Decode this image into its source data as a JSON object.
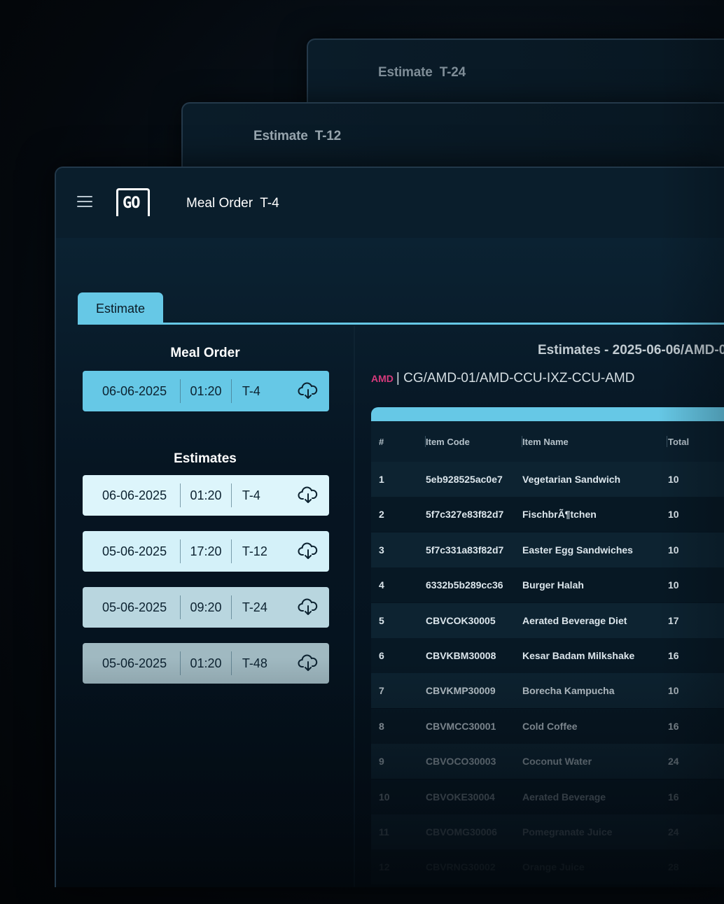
{
  "background_windows": [
    {
      "title": "Estimate  T-24"
    },
    {
      "title": "Estimate  T-12"
    }
  ],
  "topbar": {
    "logo_text": "GO",
    "title": "Meal Order  T-4"
  },
  "tabs": [
    {
      "label": "Estimate"
    }
  ],
  "left_panel": {
    "meal_order_title": "Meal Order",
    "meal_order": {
      "date": "06-06-2025",
      "time": "01:20",
      "tag": "T-4"
    },
    "estimates_title": "Estimates",
    "estimates": [
      {
        "date": "06-06-2025",
        "time": "01:20",
        "tag": "T-4"
      },
      {
        "date": "05-06-2025",
        "time": "17:20",
        "tag": "T-12"
      },
      {
        "date": "05-06-2025",
        "time": "09:20",
        "tag": "T-24"
      },
      {
        "date": "05-06-2025",
        "time": "01:20",
        "tag": "T-48"
      }
    ]
  },
  "right_panel": {
    "header": "Estimates - 2025-06-06/AMD-0",
    "route_tag": "AMD",
    "route": "| CG/AMD-01/AMD-CCU-IXZ-CCU-AMD",
    "columns": [
      "#",
      "Item Code",
      "Item Name",
      "Total"
    ],
    "rows": [
      {
        "n": "1",
        "code": "5eb928525ac0e7",
        "name": "Vegetarian Sandwich",
        "total": "10"
      },
      {
        "n": "2",
        "code": "5f7c327e83f82d7",
        "name": "FischbrÃ¶tchen",
        "total": "10"
      },
      {
        "n": "3",
        "code": "5f7c331a83f82d7",
        "name": "Easter Egg Sandwiches",
        "total": "10"
      },
      {
        "n": "4",
        "code": "6332b5b289cc36",
        "name": "Burger Halah",
        "total": "10"
      },
      {
        "n": "5",
        "code": "CBVCOK30005",
        "name": "Aerated Beverage Diet",
        "total": "17"
      },
      {
        "n": "6",
        "code": "CBVKBM30008",
        "name": "Kesar Badam Milkshake",
        "total": "16"
      },
      {
        "n": "7",
        "code": "CBVKMP30009",
        "name": "Borecha Kampucha",
        "total": "10"
      },
      {
        "n": "8",
        "code": "CBVMCC30001",
        "name": "Cold Coffee",
        "total": "16"
      },
      {
        "n": "9",
        "code": "CBVOCO30003",
        "name": "Coconut Water",
        "total": "24"
      },
      {
        "n": "10",
        "code": "CBVOKE30004",
        "name": "Aerated Beverage",
        "total": "16"
      },
      {
        "n": "11",
        "code": "CBVOMG30006",
        "name": "Pomegranate Juice",
        "total": "24"
      },
      {
        "n": "12",
        "code": "CBVRNG30002",
        "name": "Orange Juice",
        "total": "28"
      }
    ]
  },
  "colors": {
    "accent": "#66c8e6",
    "entry_light": "#ddf5fb",
    "route_tag": "#d63a7c"
  }
}
